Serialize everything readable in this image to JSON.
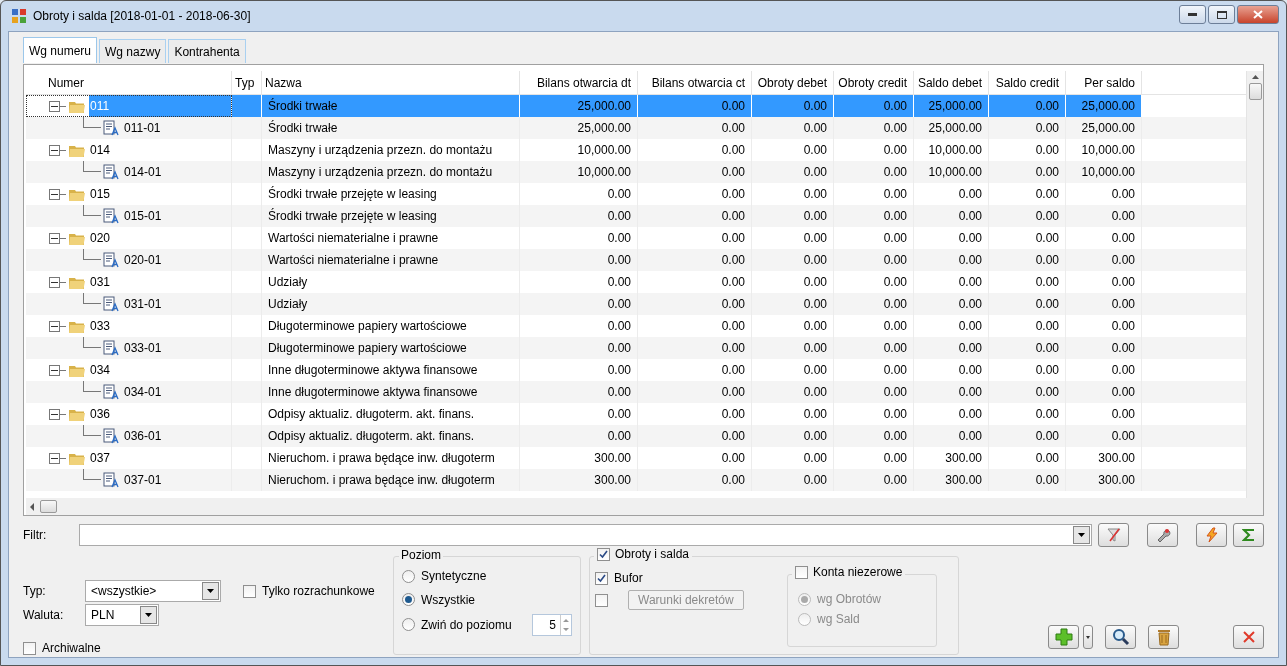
{
  "window": {
    "title": "Obroty i salda [2018-01-01 - 2018-06-30]"
  },
  "tabs": [
    {
      "label": "Wg numeru",
      "selected": true
    },
    {
      "label": "Wg nazwy",
      "selected": false
    },
    {
      "label": "Kontrahenta",
      "selected": false
    }
  ],
  "table": {
    "columns": [
      "Numer",
      "Typ",
      "Nazwa",
      "Bilans otwarcia dt",
      "Bilans otwarcia ct",
      "Obroty debet",
      "Obroty credit",
      "Saldo debet",
      "Saldo credit",
      "Per saldo"
    ],
    "rows": [
      {
        "cells": [
          "011",
          "",
          "Środki trwałe",
          "25,000.00",
          "0.00",
          "0.00",
          "0.00",
          "25,000.00",
          "0.00",
          "25,000.00"
        ],
        "selected": true,
        "expanded": true,
        "children": [
          {
            "cells": [
              "011-01",
              "",
              "Środki trwałe",
              "25,000.00",
              "0.00",
              "0.00",
              "0.00",
              "25,000.00",
              "0.00",
              "25,000.00"
            ],
            "selected": false
          }
        ]
      },
      {
        "cells": [
          "014",
          "",
          "Maszyny i urządzenia przezn. do montażu",
          "10,000.00",
          "0.00",
          "0.00",
          "0.00",
          "10,000.00",
          "0.00",
          "10,000.00"
        ],
        "selected": false,
        "expanded": true,
        "children": [
          {
            "cells": [
              "014-01",
              "",
              "Maszyny i urządzenia przezn. do montażu",
              "10,000.00",
              "0.00",
              "0.00",
              "0.00",
              "10,000.00",
              "0.00",
              "10,000.00"
            ],
            "selected": false
          }
        ]
      },
      {
        "cells": [
          "015",
          "",
          "Środki trwałe przejęte w leasing",
          "0.00",
          "0.00",
          "0.00",
          "0.00",
          "0.00",
          "0.00",
          "0.00"
        ],
        "selected": false,
        "expanded": true,
        "children": [
          {
            "cells": [
              "015-01",
              "",
              "Środki trwałe przejęte w leasing",
              "0.00",
              "0.00",
              "0.00",
              "0.00",
              "0.00",
              "0.00",
              "0.00"
            ],
            "selected": false
          }
        ]
      },
      {
        "cells": [
          "020",
          "",
          "Wartości niematerialne i prawne",
          "0.00",
          "0.00",
          "0.00",
          "0.00",
          "0.00",
          "0.00",
          "0.00"
        ],
        "selected": false,
        "expanded": true,
        "children": [
          {
            "cells": [
              "020-01",
              "",
              "Wartości niematerialne i prawne",
              "0.00",
              "0.00",
              "0.00",
              "0.00",
              "0.00",
              "0.00",
              "0.00"
            ],
            "selected": false
          }
        ]
      },
      {
        "cells": [
          "031",
          "",
          "Udziały",
          "0.00",
          "0.00",
          "0.00",
          "0.00",
          "0.00",
          "0.00",
          "0.00"
        ],
        "selected": false,
        "expanded": true,
        "children": [
          {
            "cells": [
              "031-01",
              "",
              "Udziały",
              "0.00",
              "0.00",
              "0.00",
              "0.00",
              "0.00",
              "0.00",
              "0.00"
            ],
            "selected": false
          }
        ]
      },
      {
        "cells": [
          "033",
          "",
          "Długoterminowe papiery wartościowe",
          "0.00",
          "0.00",
          "0.00",
          "0.00",
          "0.00",
          "0.00",
          "0.00"
        ],
        "selected": false,
        "expanded": true,
        "children": [
          {
            "cells": [
              "033-01",
              "",
              "Długoterminowe papiery wartościowe",
              "0.00",
              "0.00",
              "0.00",
              "0.00",
              "0.00",
              "0.00",
              "0.00"
            ],
            "selected": false
          }
        ]
      },
      {
        "cells": [
          "034",
          "",
          "Inne długoterminowe aktywa finansowe",
          "0.00",
          "0.00",
          "0.00",
          "0.00",
          "0.00",
          "0.00",
          "0.00"
        ],
        "selected": false,
        "expanded": true,
        "children": [
          {
            "cells": [
              "034-01",
              "",
              "Inne długoterminowe aktywa finansowe",
              "0.00",
              "0.00",
              "0.00",
              "0.00",
              "0.00",
              "0.00",
              "0.00"
            ],
            "selected": false
          }
        ]
      },
      {
        "cells": [
          "036",
          "",
          "Odpisy aktualiz. długoterm. akt. finans.",
          "0.00",
          "0.00",
          "0.00",
          "0.00",
          "0.00",
          "0.00",
          "0.00"
        ],
        "selected": false,
        "expanded": true,
        "children": [
          {
            "cells": [
              "036-01",
              "",
              "Odpisy aktualiz. długoterm. akt. finans.",
              "0.00",
              "0.00",
              "0.00",
              "0.00",
              "0.00",
              "0.00",
              "0.00"
            ],
            "selected": false
          }
        ]
      },
      {
        "cells": [
          "037",
          "",
          "Nieruchom. i prawa będące inw. długoterm",
          "300.00",
          "0.00",
          "0.00",
          "0.00",
          "300.00",
          "0.00",
          "300.00"
        ],
        "selected": false,
        "expanded": true,
        "children": [
          {
            "cells": [
              "037-01",
              "",
              "Nieruchom. i prawa będące inw. długoterm",
              "300.00",
              "0.00",
              "0.00",
              "0.00",
              "300.00",
              "0.00",
              "300.00"
            ],
            "selected": false
          }
        ]
      }
    ]
  },
  "filter": {
    "label": "Filtr:"
  },
  "typ": {
    "label": "Typ:",
    "value": "<wszystkie>"
  },
  "waluta": {
    "label": "Waluta:",
    "value": "PLN"
  },
  "tylko_rozrachunkowe": {
    "label": "Tylko rozrachunkowe",
    "checked": false
  },
  "archiwalne": {
    "label": "Archiwalne",
    "checked": false
  },
  "poziom": {
    "title": "Poziom",
    "options": [
      {
        "label": "Syntetyczne",
        "selected": false
      },
      {
        "label": "Wszystkie",
        "selected": true
      },
      {
        "label": "Zwiń do poziomu",
        "selected": false
      }
    ],
    "level_value": "5"
  },
  "obroty": {
    "label": "Obroty i salda",
    "checked": true
  },
  "bufor": {
    "label": "Bufor",
    "checked": true
  },
  "warunki": {
    "checked": false,
    "button": "Warunki dekretów",
    "disabled": true
  },
  "konta_niezerowe": {
    "label": "Konta niezerowe",
    "checked": false,
    "options": [
      {
        "label": "wg Obrotów",
        "selected": true,
        "disabled": true
      },
      {
        "label": "wg Sald",
        "selected": false,
        "disabled": true
      }
    ]
  }
}
